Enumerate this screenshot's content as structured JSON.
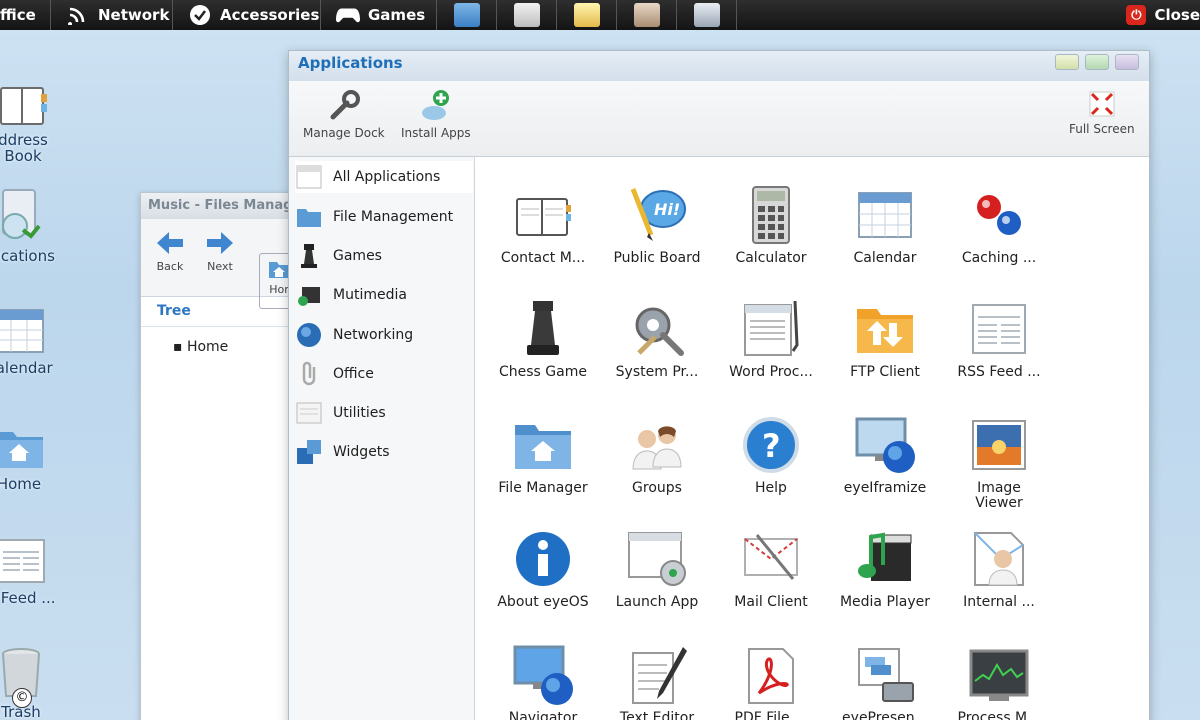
{
  "topbar": {
    "menus": [
      {
        "label": "ffice",
        "icon": "office-icon"
      },
      {
        "label": "Network",
        "icon": "network-icon"
      },
      {
        "label": "Accessories",
        "icon": "accessories-icon"
      },
      {
        "label": "Games",
        "icon": "gamepad-icon"
      }
    ],
    "close_label": "Close",
    "colors": {
      "bar": "#1e1e1e",
      "close": "#d9271d"
    }
  },
  "desktop": {
    "icons": [
      {
        "label_lines": [
          "ddress",
          "Book"
        ],
        "icon": "address-book-icon"
      },
      {
        "label_lines": [
          "plications"
        ],
        "icon": "applications-icon"
      },
      {
        "label_lines": [
          "Calendar"
        ],
        "icon": "calendar-icon"
      },
      {
        "label_lines": [
          "Home"
        ],
        "icon": "home-folder-icon"
      },
      {
        "label_lines": [
          "S Feed ..."
        ],
        "icon": "rss-feed-icon"
      },
      {
        "label_lines": [
          "Trash"
        ],
        "icon": "trash-icon"
      }
    ]
  },
  "music_window": {
    "title": "Music - Files Manag",
    "tools": [
      {
        "label": "Back",
        "icon": "back-arrow-icon"
      },
      {
        "label": "Next",
        "icon": "next-arrow-icon"
      },
      {
        "label": "Hor",
        "icon": "home-icon"
      }
    ],
    "tree_header": "Tree",
    "tree_items": [
      "Home"
    ]
  },
  "applications_window": {
    "title": "Applications",
    "toolbar": {
      "manage_dock": "Manage Dock",
      "install_apps": "Install Apps",
      "full_screen": "Full Screen"
    },
    "categories": [
      {
        "label": "All Applications",
        "icon": "all-apps-icon",
        "selected": true
      },
      {
        "label": "File Management",
        "icon": "folder-icon"
      },
      {
        "label": "Games",
        "icon": "chess-icon"
      },
      {
        "label": "Mutimedia",
        "icon": "multimedia-icon"
      },
      {
        "label": "Networking",
        "icon": "globe-icon"
      },
      {
        "label": "Office",
        "icon": "paperclip-icon"
      },
      {
        "label": "Utilities",
        "icon": "utilities-icon"
      },
      {
        "label": "Widgets",
        "icon": "widgets-icon"
      }
    ],
    "apps": [
      {
        "label_lines": [
          "Contact M..."
        ],
        "icon": "contact-manager-icon"
      },
      {
        "label_lines": [
          "Public Board"
        ],
        "icon": "public-board-icon"
      },
      {
        "label_lines": [
          "Calculator"
        ],
        "icon": "calculator-icon"
      },
      {
        "label_lines": [
          "Calendar"
        ],
        "icon": "calendar-icon"
      },
      {
        "label_lines": [
          "Caching ..."
        ],
        "icon": "caching-icon"
      },
      {
        "label_lines": [
          "Chess Game"
        ],
        "icon": "chess-game-icon"
      },
      {
        "label_lines": [
          "System Pr..."
        ],
        "icon": "system-preferences-icon"
      },
      {
        "label_lines": [
          "Word Proc..."
        ],
        "icon": "word-processor-icon"
      },
      {
        "label_lines": [
          "FTP Client"
        ],
        "icon": "ftp-client-icon"
      },
      {
        "label_lines": [
          "RSS Feed ..."
        ],
        "icon": "rss-feed-icon"
      },
      {
        "label_lines": [
          "File Manager"
        ],
        "icon": "file-manager-icon"
      },
      {
        "label_lines": [
          "Groups"
        ],
        "icon": "groups-icon"
      },
      {
        "label_lines": [
          "Help"
        ],
        "icon": "help-icon"
      },
      {
        "label_lines": [
          "eyeIframize"
        ],
        "icon": "iframize-icon"
      },
      {
        "label_lines": [
          "Image",
          "Viewer"
        ],
        "icon": "image-viewer-icon"
      },
      {
        "label_lines": [
          "About eyeOS"
        ],
        "icon": "about-info-icon"
      },
      {
        "label_lines": [
          "Launch App"
        ],
        "icon": "launch-app-icon"
      },
      {
        "label_lines": [
          "Mail Client"
        ],
        "icon": "mail-client-icon"
      },
      {
        "label_lines": [
          "Media Player"
        ],
        "icon": "media-player-icon"
      },
      {
        "label_lines": [
          "Internal ..."
        ],
        "icon": "internal-messages-icon"
      },
      {
        "label_lines": [
          "Navigator"
        ],
        "icon": "navigator-icon"
      },
      {
        "label_lines": [
          "Text Editor"
        ],
        "icon": "text-editor-icon"
      },
      {
        "label_lines": [
          "PDF File ..."
        ],
        "icon": "pdf-file-icon"
      },
      {
        "label_lines": [
          "eyePresen..."
        ],
        "icon": "presentation-icon"
      },
      {
        "label_lines": [
          "Process M..."
        ],
        "icon": "process-manager-icon"
      }
    ]
  },
  "copyright_mark": "©"
}
